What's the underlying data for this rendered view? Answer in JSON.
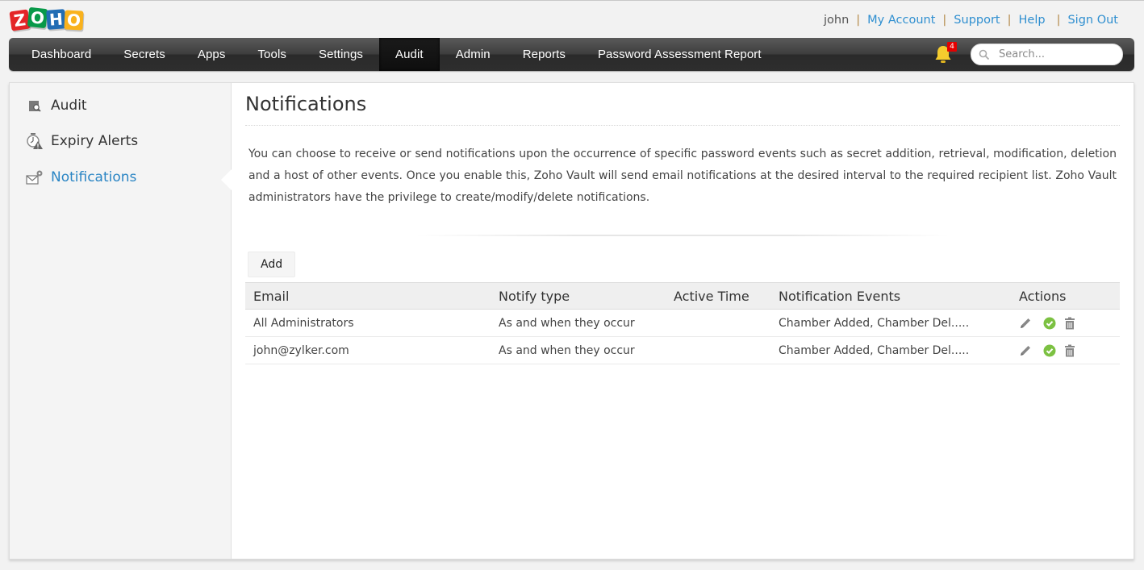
{
  "brand": {
    "logo_letters": [
      "Z",
      "O",
      "H",
      "O"
    ]
  },
  "top_links": {
    "user": "john",
    "separator": "|",
    "my_account": "My Account",
    "support": "Support",
    "help": "Help",
    "sign_out": "Sign Out"
  },
  "nav": {
    "items": [
      {
        "label": "Dashboard"
      },
      {
        "label": "Secrets"
      },
      {
        "label": "Apps"
      },
      {
        "label": "Tools"
      },
      {
        "label": "Settings"
      },
      {
        "label": "Audit",
        "active": true
      },
      {
        "label": "Admin"
      },
      {
        "label": "Reports"
      },
      {
        "label": "Password Assessment Report"
      }
    ],
    "notification_count": "4",
    "search_placeholder": "Search..."
  },
  "sidebar": {
    "items": [
      {
        "label": "Audit",
        "icon": "audit-icon"
      },
      {
        "label": "Expiry Alerts",
        "icon": "expiry-alert-icon"
      },
      {
        "label": "Notifications",
        "icon": "notification-settings-icon",
        "active": true
      }
    ]
  },
  "main": {
    "title": "Notifications",
    "description": "You can choose to receive or send notifications upon the occurrence of specific password events such as secret addition, retrieval, modification, deletion and a host of other events. Once you enable this, Zoho Vault will send email notifications at the desired interval to the required recipient list. Zoho Vault administrators have the privilege to create/modify/delete notifications.",
    "add_label": "Add",
    "table": {
      "columns": [
        "Email",
        "Notify type",
        "Active Time",
        "Notification Events",
        "Actions"
      ],
      "rows": [
        {
          "email": "All Administrators",
          "notify_type": "As and when they occur",
          "active_time": "",
          "events": "Chamber Added, Chamber Del....."
        },
        {
          "email": " john@zylker.com",
          "notify_type": "As and when they occur",
          "active_time": "",
          "events": "Chamber Added, Chamber Del....."
        }
      ]
    }
  },
  "colors": {
    "link": "#2f8fd0",
    "active_sidebar": "#2a85c4",
    "enabled_check": "#7cc142",
    "badge": "#e40000",
    "bell": "#f5cc2e"
  }
}
